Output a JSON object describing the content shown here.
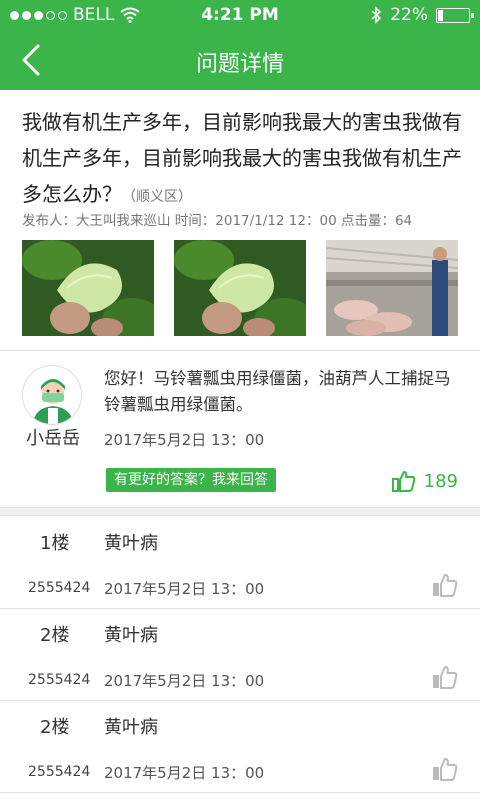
{
  "status_bar": {
    "carrier": "BELL",
    "time": "4:21 PM",
    "battery": "22%",
    "battery_level": 0.22
  },
  "nav": {
    "title": "问题详情"
  },
  "question": {
    "text": "我做有机生产多年，目前影响我最大的害虫我做有机生产多年，目前影响我最大的害虫我做有机生产多怎么办？",
    "location": "（顺义区）",
    "meta": "发布人：大王叫我来巡山 时间：2017/1/12 12：00 点击量：64"
  },
  "answer": {
    "name": "小岳岳",
    "text": "您好！马铃薯瓢虫用绿僵菌，油葫芦人工捕捉马铃薯瓢虫用绿僵菌。",
    "time": "2017年5月2日 13：00",
    "better_button": "有更好的答案？我来回答",
    "likes": "189"
  },
  "replies": [
    {
      "floor": "1楼",
      "content": "黄叶病",
      "uid": "2555424",
      "time": "2017年5月2日 13：00"
    },
    {
      "floor": "2楼",
      "content": "黄叶病",
      "uid": "2555424",
      "time": "2017年5月2日 13：00"
    },
    {
      "floor": "2楼",
      "content": "黄叶病",
      "uid": "2555424",
      "time": "2017年5月2日 13：00"
    }
  ],
  "colors": {
    "brand": "#3bb54a",
    "like_inactive": "#bbbbbb"
  }
}
